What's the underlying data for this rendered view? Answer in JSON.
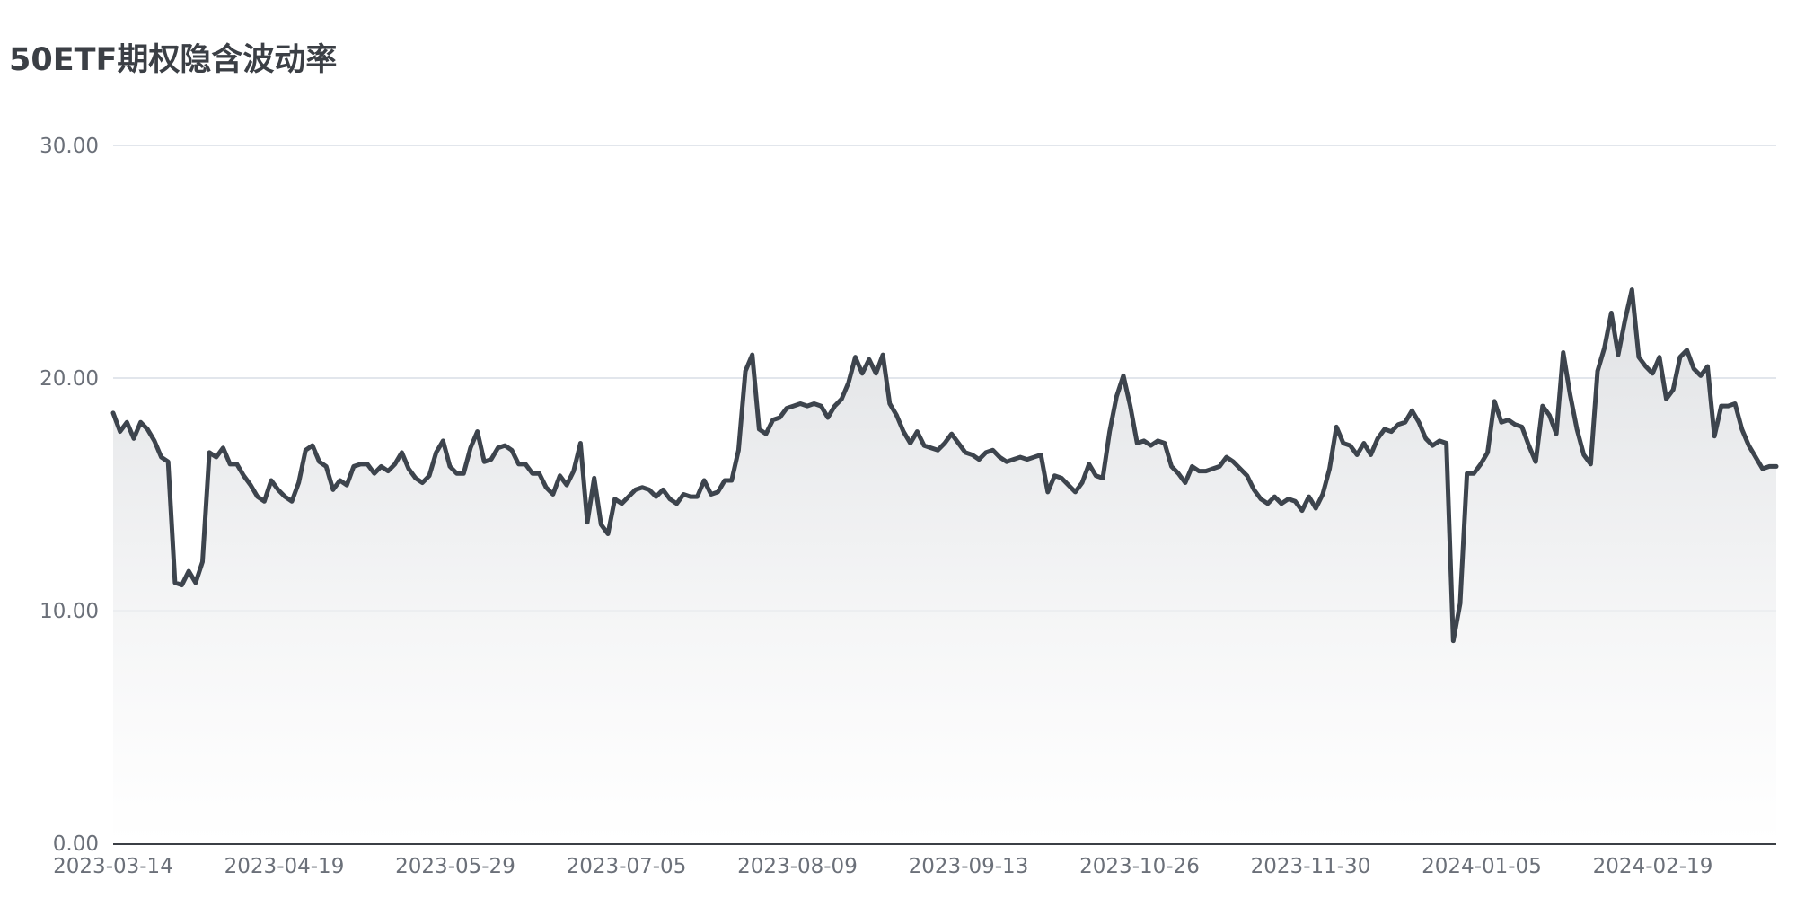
{
  "chart_data": {
    "type": "area",
    "title": "50ETF期权隐含波动率",
    "xlabel": "",
    "ylabel": "",
    "ylim": [
      0,
      30
    ],
    "y_ticks": [
      "0.00",
      "10.00",
      "20.00",
      "30.00"
    ],
    "x_tick_labels": [
      "2023-03-14",
      "2023-04-19",
      "2023-05-29",
      "2023-07-05",
      "2023-08-09",
      "2023-09-13",
      "2023-10-26",
      "2023-11-30",
      "2024-01-05",
      "2024-02-19"
    ],
    "grid": true,
    "colors": {
      "line": "#3d444d",
      "area_top": "#dcdee1",
      "area_bottom": "#ffffff",
      "grid": "#d9dde6",
      "axis": "#3b3f45"
    },
    "series": [
      {
        "values": [
          18.5,
          17.7,
          18.1,
          17.4,
          18.1,
          17.8,
          17.3,
          16.6,
          16.4,
          11.2,
          11.1,
          11.7,
          11.2,
          12.1,
          16.8,
          16.6,
          17.0,
          16.3,
          16.3,
          15.8,
          15.4,
          14.9,
          14.7,
          15.6,
          15.2,
          14.9,
          14.7,
          15.5,
          16.9,
          17.1,
          16.4,
          16.2,
          15.2,
          15.6,
          15.4,
          16.2,
          16.3,
          16.3,
          15.9,
          16.2,
          16.0,
          16.3,
          16.8,
          16.1,
          15.7,
          15.5,
          15.8,
          16.8,
          17.3,
          16.2,
          15.9,
          15.9,
          17.0,
          17.7,
          16.4,
          16.5,
          17.0,
          17.1,
          16.9,
          16.3,
          16.3,
          15.9,
          15.9,
          15.3,
          15.0,
          15.8,
          15.4,
          16.0,
          17.2,
          13.8,
          15.7,
          13.7,
          13.3,
          14.8,
          14.6,
          14.9,
          15.2,
          15.3,
          15.2,
          14.9,
          15.2,
          14.8,
          14.6,
          15.0,
          14.9,
          14.9,
          15.6,
          15.0,
          15.1,
          15.6,
          15.6,
          16.9,
          20.3,
          21.0,
          17.8,
          17.6,
          18.2,
          18.3,
          18.7,
          18.8,
          18.9,
          18.8,
          18.9,
          18.8,
          18.3,
          18.8,
          19.1,
          19.8,
          20.9,
          20.2,
          20.8,
          20.2,
          21.0,
          18.9,
          18.4,
          17.7,
          17.2,
          17.7,
          17.1,
          17.0,
          16.9,
          17.2,
          17.6,
          17.2,
          16.8,
          16.7,
          16.5,
          16.8,
          16.9,
          16.6,
          16.4,
          16.5,
          16.6,
          16.5,
          16.6,
          16.7,
          15.1,
          15.8,
          15.7,
          15.4,
          15.1,
          15.5,
          16.3,
          15.8,
          15.7,
          17.7,
          19.2,
          20.1,
          18.8,
          17.2,
          17.3,
          17.1,
          17.3,
          17.2,
          16.2,
          15.9,
          15.5,
          16.2,
          16.0,
          16.0,
          16.1,
          16.2,
          16.6,
          16.4,
          16.1,
          15.8,
          15.2,
          14.8,
          14.6,
          14.9,
          14.6,
          14.8,
          14.7,
          14.3,
          14.9,
          14.4,
          15.0,
          16.1,
          17.9,
          17.2,
          17.1,
          16.7,
          17.2,
          16.7,
          17.4,
          17.8,
          17.7,
          18.0,
          18.1,
          18.6,
          18.1,
          17.4,
          17.1,
          17.3,
          17.2,
          8.7,
          10.3,
          15.9,
          15.9,
          16.3,
          16.8,
          19.0,
          18.1,
          18.2,
          18.0,
          17.9,
          17.1,
          16.4,
          18.8,
          18.4,
          17.6,
          21.1,
          19.3,
          17.8,
          16.7,
          16.3,
          20.3,
          21.3,
          22.8,
          21.0,
          22.5,
          23.8,
          20.9,
          20.5,
          20.2,
          20.9,
          19.1,
          19.5,
          20.9,
          21.2,
          20.4,
          20.1,
          20.5,
          17.5,
          18.8,
          18.8,
          18.9,
          17.8,
          17.1,
          16.6,
          16.1,
          16.2,
          16.2
        ]
      }
    ]
  }
}
